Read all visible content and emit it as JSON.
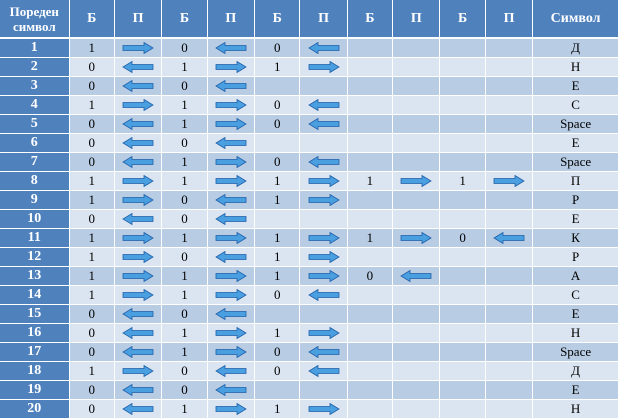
{
  "header": {
    "index_label": "Пореден символ",
    "b_label": "Б",
    "p_label": "П",
    "symbol_label": "Символ"
  },
  "arrow_legend": {
    "r": "right-arrow-icon",
    "l": "left-arrow-icon"
  },
  "colors": {
    "header_bg": "#4f81bd",
    "row_odd": "#b8cce4",
    "row_even": "#dbe5f1",
    "arrow_fill": "#4a9fe0",
    "arrow_stroke": "#1f5fa8"
  },
  "rows": [
    {
      "n": "1",
      "cells": [
        [
          "1",
          "r"
        ],
        [
          "0",
          "l"
        ],
        [
          "0",
          "l"
        ],
        [
          "",
          ""
        ],
        [
          "",
          ""
        ]
      ],
      "symbol": "Д"
    },
    {
      "n": "2",
      "cells": [
        [
          "0",
          "l"
        ],
        [
          "1",
          "r"
        ],
        [
          "1",
          "r"
        ],
        [
          "",
          ""
        ],
        [
          "",
          ""
        ]
      ],
      "symbol": "Н"
    },
    {
      "n": "3",
      "cells": [
        [
          "0",
          "l"
        ],
        [
          "0",
          "l"
        ],
        [
          "",
          ""
        ],
        [
          "",
          ""
        ],
        [
          "",
          ""
        ]
      ],
      "symbol": "Е"
    },
    {
      "n": "4",
      "cells": [
        [
          "1",
          "r"
        ],
        [
          "1",
          "r"
        ],
        [
          "0",
          "l"
        ],
        [
          "",
          ""
        ],
        [
          "",
          ""
        ]
      ],
      "symbol": "С"
    },
    {
      "n": "5",
      "cells": [
        [
          "0",
          "l"
        ],
        [
          "1",
          "r"
        ],
        [
          "0",
          "l"
        ],
        [
          "",
          ""
        ],
        [
          "",
          ""
        ]
      ],
      "symbol": "Space"
    },
    {
      "n": "6",
      "cells": [
        [
          "0",
          "l"
        ],
        [
          "0",
          "l"
        ],
        [
          "",
          ""
        ],
        [
          "",
          ""
        ],
        [
          "",
          ""
        ]
      ],
      "symbol": "Е"
    },
    {
      "n": "7",
      "cells": [
        [
          "0",
          "l"
        ],
        [
          "1",
          "r"
        ],
        [
          "0",
          "l"
        ],
        [
          "",
          ""
        ],
        [
          "",
          ""
        ]
      ],
      "symbol": "Space"
    },
    {
      "n": "8",
      "cells": [
        [
          "1",
          "r"
        ],
        [
          "1",
          "r"
        ],
        [
          "1",
          "r"
        ],
        [
          "1",
          "r"
        ],
        [
          "1",
          "r"
        ]
      ],
      "symbol": "П"
    },
    {
      "n": "9",
      "cells": [
        [
          "1",
          "r"
        ],
        [
          "0",
          "l"
        ],
        [
          "1",
          "r"
        ],
        [
          "",
          ""
        ],
        [
          "",
          ""
        ]
      ],
      "symbol": "Р"
    },
    {
      "n": "10",
      "cells": [
        [
          "0",
          "l"
        ],
        [
          "0",
          "l"
        ],
        [
          "",
          ""
        ],
        [
          "",
          ""
        ],
        [
          "",
          ""
        ]
      ],
      "symbol": "Е"
    },
    {
      "n": "11",
      "cells": [
        [
          "1",
          "r"
        ],
        [
          "1",
          "r"
        ],
        [
          "1",
          "r"
        ],
        [
          "1",
          "r"
        ],
        [
          "0",
          "l"
        ]
      ],
      "symbol": "К"
    },
    {
      "n": "12",
      "cells": [
        [
          "1",
          "r"
        ],
        [
          "0",
          "l"
        ],
        [
          "1",
          "r"
        ],
        [
          "",
          ""
        ],
        [
          "",
          ""
        ]
      ],
      "symbol": "Р"
    },
    {
      "n": "13",
      "cells": [
        [
          "1",
          "r"
        ],
        [
          "1",
          "r"
        ],
        [
          "1",
          "r"
        ],
        [
          "0",
          "l"
        ],
        [
          "",
          ""
        ]
      ],
      "symbol": "А"
    },
    {
      "n": "14",
      "cells": [
        [
          "1",
          "r"
        ],
        [
          "1",
          "r"
        ],
        [
          "0",
          "l"
        ],
        [
          "",
          ""
        ],
        [
          "",
          ""
        ]
      ],
      "symbol": "С"
    },
    {
      "n": "15",
      "cells": [
        [
          "0",
          "l"
        ],
        [
          "0",
          "l"
        ],
        [
          "",
          ""
        ],
        [
          "",
          ""
        ],
        [
          "",
          ""
        ]
      ],
      "symbol": "Е"
    },
    {
      "n": "16",
      "cells": [
        [
          "0",
          "l"
        ],
        [
          "1",
          "r"
        ],
        [
          "1",
          "r"
        ],
        [
          "",
          ""
        ],
        [
          "",
          ""
        ]
      ],
      "symbol": "Н"
    },
    {
      "n": "17",
      "cells": [
        [
          "0",
          "l"
        ],
        [
          "1",
          "r"
        ],
        [
          "0",
          "l"
        ],
        [
          "",
          ""
        ],
        [
          "",
          ""
        ]
      ],
      "symbol": "Space"
    },
    {
      "n": "18",
      "cells": [
        [
          "1",
          "r"
        ],
        [
          "0",
          "l"
        ],
        [
          "0",
          "l"
        ],
        [
          "",
          ""
        ],
        [
          "",
          ""
        ]
      ],
      "symbol": "Д"
    },
    {
      "n": "19",
      "cells": [
        [
          "0",
          "l"
        ],
        [
          "0",
          "l"
        ],
        [
          "",
          ""
        ],
        [
          "",
          ""
        ],
        [
          "",
          ""
        ]
      ],
      "symbol": "Е"
    },
    {
      "n": "20",
      "cells": [
        [
          "0",
          "l"
        ],
        [
          "1",
          "r"
        ],
        [
          "1",
          "r"
        ],
        [
          "",
          ""
        ],
        [
          "",
          ""
        ]
      ],
      "symbol": "Н"
    }
  ]
}
